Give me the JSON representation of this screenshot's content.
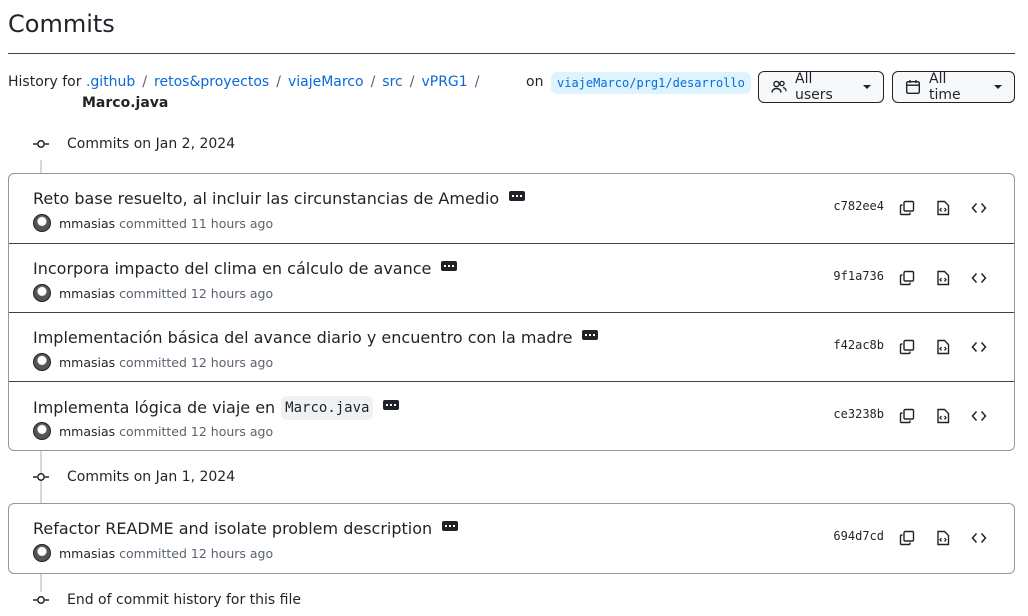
{
  "page": {
    "title": "Commits"
  },
  "history": {
    "prefix": "History for",
    "path": [
      ".github",
      "retos&proyectos",
      "viajeMarco",
      "src",
      "vPRG1"
    ],
    "separator": "/",
    "file": "Marco.java",
    "on_label": "on",
    "branch": "viajeMarco/prg1/desarrollo"
  },
  "filters": {
    "users_label": "All users",
    "time_label": "All time"
  },
  "groups": [
    {
      "heading": "Commits on Jan 2, 2024",
      "commits": [
        {
          "message": "Reto base resuelto, al incluir las circunstancias de Amedio",
          "code": "",
          "author": "mmasias",
          "time": "committed 11 hours ago",
          "sha": "c782ee4"
        },
        {
          "message": "Incorpora impacto del clima en cálculo de avance",
          "code": "",
          "author": "mmasias",
          "time": "committed 12 hours ago",
          "sha": "9f1a736"
        },
        {
          "message": "Implementación básica del avance diario y encuentro con la madre",
          "code": "",
          "author": "mmasias",
          "time": "committed 12 hours ago",
          "sha": "f42ac8b"
        },
        {
          "message": "Implementa lógica de viaje en",
          "code": "Marco.java",
          "author": "mmasias",
          "time": "committed 12 hours ago",
          "sha": "ce3238b"
        }
      ]
    },
    {
      "heading": "Commits on Jan 1, 2024",
      "commits": [
        {
          "message": "Refactor README and isolate problem description",
          "code": "",
          "author": "mmasias",
          "time": "committed 12 hours ago",
          "sha": "694d7cd"
        }
      ]
    }
  ],
  "end_text": "End of commit history for this file"
}
